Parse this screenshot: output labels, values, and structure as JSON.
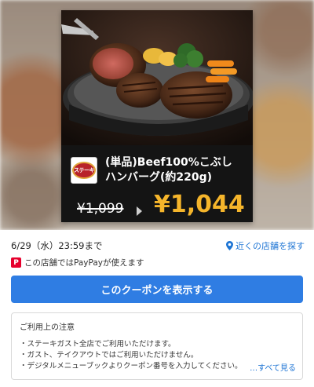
{
  "coupon": {
    "item_name_line1": "(単品)Beef100%こぶし",
    "item_name_line2": "ハンバーグ(約220g)",
    "old_price": "¥1,099",
    "new_price": "¥1,044",
    "logo_text": "ステーキ",
    "accent_color": "#f5b52b"
  },
  "info": {
    "expiry": "6/29（水）23:59まで",
    "nearby_link": "近くの店舗を探す",
    "paypay_text": "この店舗ではPayPayが使えます",
    "paypay_icon": "paypay-icon"
  },
  "cta": {
    "label": "このクーポンを表示する",
    "color": "#2f7de3"
  },
  "notes": {
    "title": "ご利用上の注意",
    "items": [
      "・ステーキガスト全店でご利用いただけます。",
      "・ガスト、テイクアウトではご利用いただけません。",
      "・デジタルメニューブックよりクーポン番号を入力してください。"
    ],
    "see_all": "…すべて見る"
  }
}
